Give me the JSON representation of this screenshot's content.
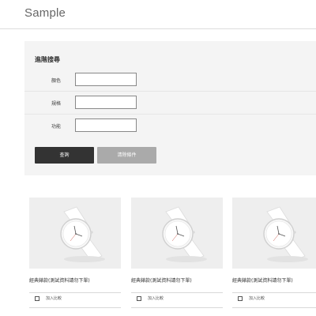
{
  "header": {
    "title": "Sample"
  },
  "search": {
    "title": "進階搜尋",
    "fields": [
      {
        "label": "顏色",
        "value": ""
      },
      {
        "label": "規格",
        "value": ""
      },
      {
        "label": "功能",
        "value": ""
      }
    ],
    "query_label": "查詢",
    "clear_label": "清除條件"
  },
  "products": [
    {
      "name": "經典錶款(測試資料請勿下單)",
      "compare_label": "加入比較",
      "image_icon": "watch-icon"
    },
    {
      "name": "經典錶款(測試資料請勿下單)",
      "compare_label": "加入比較",
      "image_icon": "watch-icon"
    },
    {
      "name": "經典錶款(測試資料請勿下單)",
      "compare_label": "加入比較",
      "image_icon": "watch-icon"
    }
  ],
  "colors": {
    "query_button": "#333333",
    "clear_button": "#aaaaaa",
    "panel_background": "#f4f4f4",
    "image_background": "#eeeeee"
  }
}
